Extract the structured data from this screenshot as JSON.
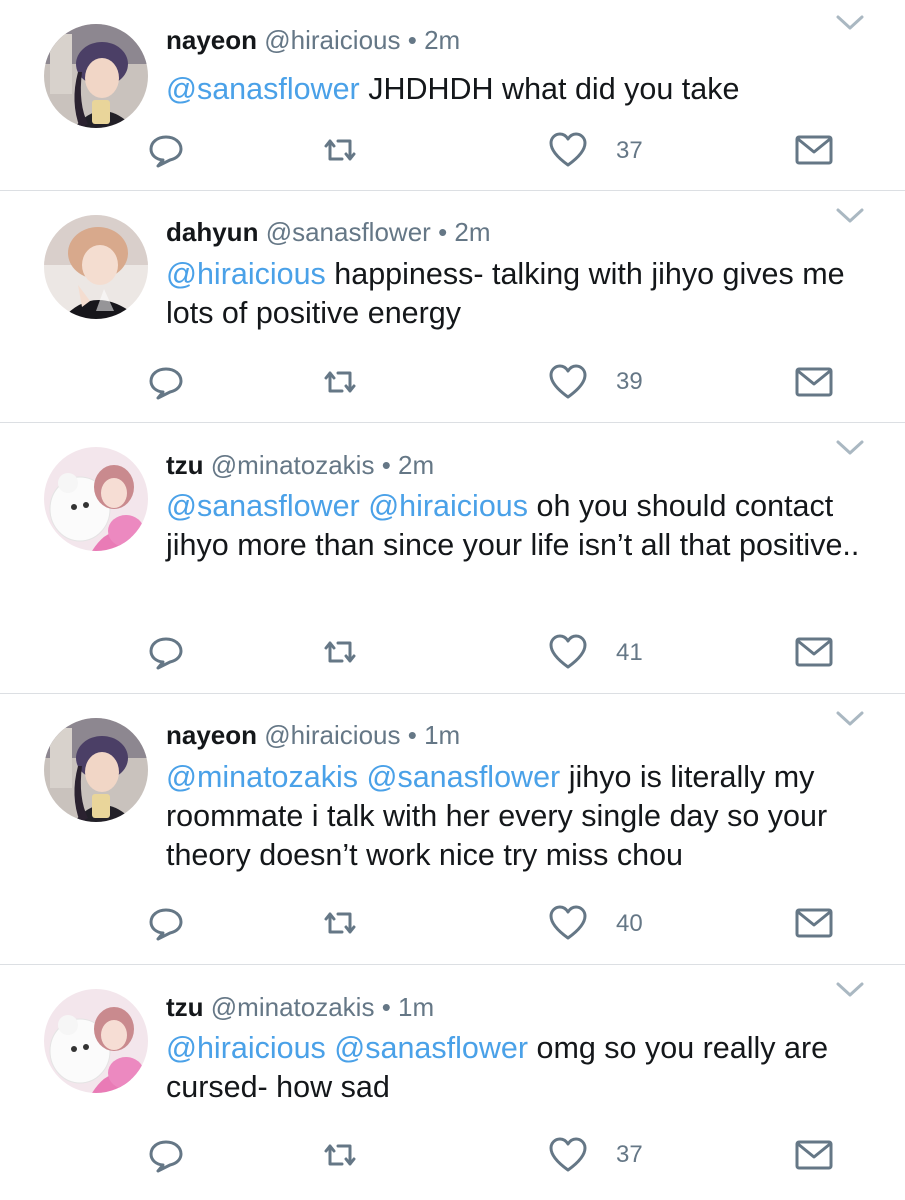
{
  "tweets": [
    {
      "name": "nayeon",
      "handle": "@hiraicious",
      "dot": "•",
      "time": "2m",
      "mentions": [
        "@sanasflower"
      ],
      "text": "JHDHDH what did you take",
      "like_count": "37",
      "avatar": "nayeon-avatar"
    },
    {
      "name": "dahyun",
      "handle": "@sanasflower",
      "dot": "•",
      "time": "2m",
      "mentions": [
        "@hiraicious"
      ],
      "text": "happiness- talking with jihyo gives me lots of positive energy",
      "like_count": "39",
      "avatar": "dahyun-avatar"
    },
    {
      "name": "tzu",
      "handle": "@minatozakis",
      "dot": "•",
      "time": "2m",
      "mentions": [
        "@sanasflower",
        "@hiraicious"
      ],
      "text": "oh you should contact jihyo more than since your life isn’t all that positive..",
      "like_count": "41",
      "avatar": "tzu-avatar"
    },
    {
      "name": "nayeon",
      "handle": "@hiraicious",
      "dot": "•",
      "time": "1m",
      "mentions": [
        "@minatozakis",
        "@sanasflower"
      ],
      "text": "jihyo is literally my roommate i talk with her every single day so your theory doesn’t work nice try miss chou",
      "like_count": "40",
      "avatar": "nayeon-avatar"
    },
    {
      "name": "tzu",
      "handle": "@minatozakis",
      "dot": "•",
      "time": "1m",
      "mentions": [
        "@hiraicious",
        "@sanasflower"
      ],
      "text": "omg so you really are cursed- how sad",
      "like_count": "37",
      "avatar": "tzu-avatar"
    }
  ],
  "icons": {
    "reply": "reply-icon",
    "retweet": "retweet-icon",
    "like": "heart-icon",
    "dm": "envelope-icon",
    "more": "chevron-down-icon"
  },
  "colors": {
    "mention": "#4aa1e8",
    "secondary_text": "#657786",
    "divider": "#dcdfe3",
    "icon": "#657786"
  }
}
